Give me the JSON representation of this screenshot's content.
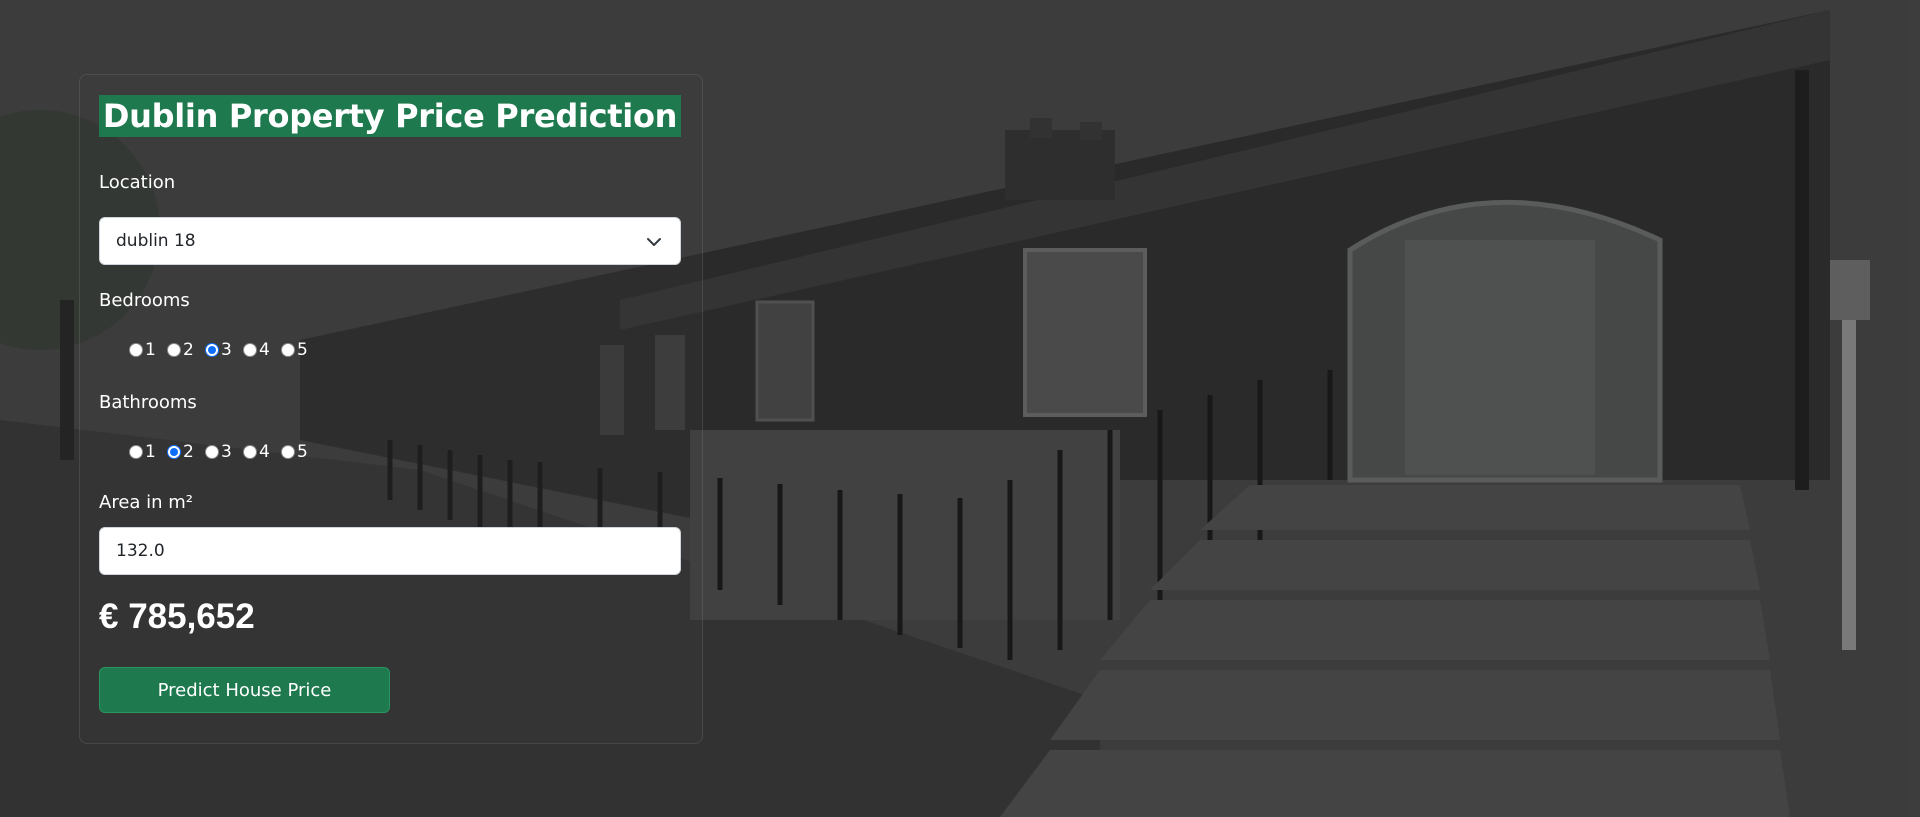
{
  "page": {
    "title": "Dublin Property Price Prediction"
  },
  "form": {
    "location": {
      "label": "Location",
      "selected": "dublin 18"
    },
    "bedrooms": {
      "label": "Bedrooms",
      "options": [
        "1",
        "2",
        "3",
        "4",
        "5"
      ],
      "selected": "3"
    },
    "bathrooms": {
      "label": "Bathrooms",
      "options": [
        "1",
        "2",
        "3",
        "4",
        "5"
      ],
      "selected": "2"
    },
    "area": {
      "label": "Area in m²",
      "value": "132.0"
    },
    "price": "€ 785,652",
    "submit_label": "Predict House Price"
  },
  "colors": {
    "accent_green": "#1e7a4e",
    "radio_blue": "#0d6efd"
  },
  "icons": {
    "select_chevron": "chevron-down-icon"
  }
}
